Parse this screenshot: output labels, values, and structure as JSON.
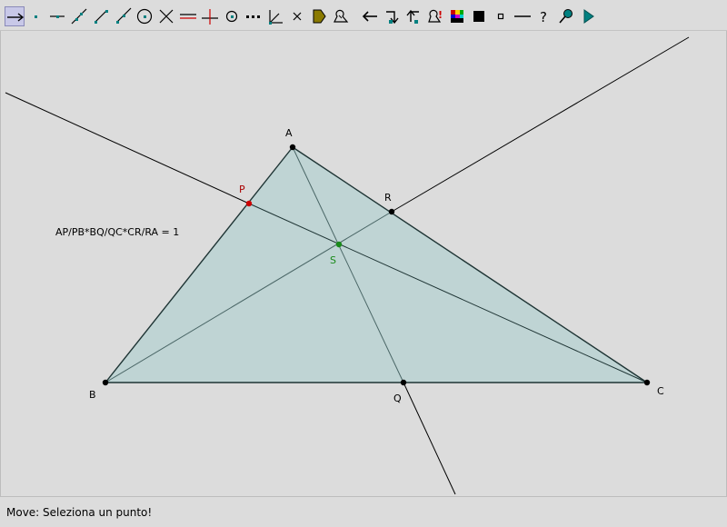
{
  "toolbar": {
    "tools": [
      {
        "name": "move-tool-icon",
        "active": true
      },
      {
        "name": "point-tool-icon"
      },
      {
        "name": "point-on-object-tool-icon"
      },
      {
        "name": "line-tool-icon"
      },
      {
        "name": "segment-tool-icon"
      },
      {
        "name": "ray-tool-icon"
      },
      {
        "name": "circle-tool-icon"
      },
      {
        "name": "intersection-tool-icon"
      },
      {
        "name": "parallel-line-tool-icon"
      },
      {
        "name": "perpendicular-line-tool-icon"
      },
      {
        "name": "midpoint-tool-icon"
      },
      {
        "name": "locus-tool-icon"
      },
      {
        "name": "angle-tool-icon"
      },
      {
        "name": "delete-tool-icon"
      },
      {
        "name": "label-tag-icon"
      },
      {
        "name": "measure-tool-icon"
      },
      {
        "name": "undo-arrow-icon"
      },
      {
        "name": "redo-arrow-icon"
      },
      {
        "name": "back-arrow-icon"
      },
      {
        "name": "calculator-icon"
      },
      {
        "name": "color-palette-icon"
      },
      {
        "name": "filled-square-icon"
      },
      {
        "name": "small-square-icon"
      },
      {
        "name": "line-style-icon"
      },
      {
        "name": "help-question-icon"
      },
      {
        "name": "zoom-pin-icon"
      },
      {
        "name": "play-animation-icon"
      }
    ]
  },
  "points": {
    "A": {
      "label": "A"
    },
    "B": {
      "label": "B"
    },
    "C": {
      "label": "C"
    },
    "P": {
      "label": "P"
    },
    "Q": {
      "label": "Q"
    },
    "R": {
      "label": "R"
    },
    "S": {
      "label": "S"
    }
  },
  "formula": "AP/PB*BQ/QC*CR/RA = 1",
  "status": "Move: Seleziona un punto!",
  "colors": {
    "triangle_fill": "#bfd4d4",
    "point_normal": "#000000",
    "point_P": "#cc0000",
    "point_S": "#1a8a1a",
    "label_P": "#aa0000",
    "label_S": "#1a8a1a"
  }
}
